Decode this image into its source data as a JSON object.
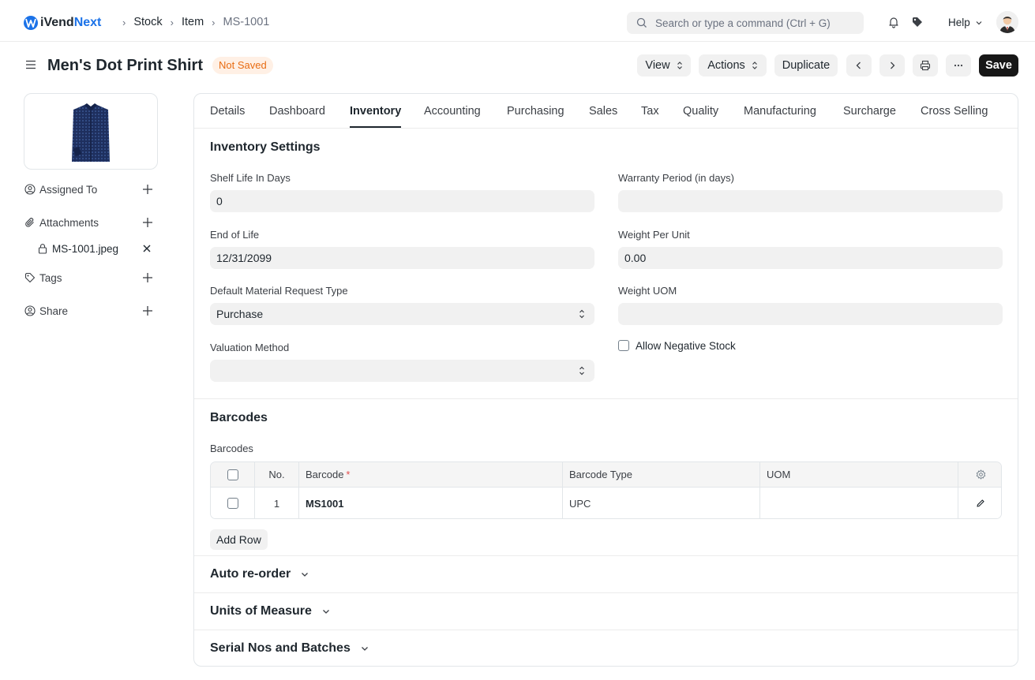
{
  "app": {
    "logo_prefix": "iVend",
    "logo_accent": "Next",
    "brand_color": "#1b72e8"
  },
  "breadcrumb": [
    "Stock",
    "Item",
    "MS-1001"
  ],
  "search": {
    "placeholder": "Search or type a command (Ctrl + G)"
  },
  "navbar": {
    "help_label": "Help"
  },
  "page": {
    "title": "Men's Dot Print Shirt",
    "status": "Not Saved",
    "buttons": {
      "view": "View",
      "actions": "Actions",
      "duplicate": "Duplicate",
      "save": "Save"
    }
  },
  "sidebar": {
    "assigned_to": "Assigned To",
    "attachments": "Attachments",
    "attachment_file": "MS-1001.jpeg",
    "tags": "Tags",
    "share": "Share"
  },
  "tabs": [
    "Details",
    "Dashboard",
    "Inventory",
    "Accounting",
    "Purchasing",
    "Sales",
    "Tax",
    "Quality",
    "Manufacturing",
    "Surcharge",
    "Cross Selling"
  ],
  "active_tab": "Inventory",
  "inventory": {
    "section_title": "Inventory Settings",
    "shelf_life_label": "Shelf Life In Days",
    "shelf_life_value": "0",
    "warranty_label": "Warranty Period (in days)",
    "warranty_value": "",
    "end_of_life_label": "End of Life",
    "end_of_life_value": "12/31/2099",
    "weight_per_unit_label": "Weight Per Unit",
    "weight_per_unit_value": "0.00",
    "material_request_label": "Default Material Request Type",
    "material_request_value": "Purchase",
    "weight_uom_label": "Weight UOM",
    "weight_uom_value": "",
    "valuation_label": "Valuation Method",
    "valuation_value": "",
    "allow_negative_label": "Allow Negative Stock",
    "allow_negative_checked": false
  },
  "barcodes": {
    "section_title": "Barcodes",
    "table_label": "Barcodes",
    "columns": {
      "no": "No.",
      "barcode": "Barcode",
      "barcode_type": "Barcode Type",
      "uom": "UOM"
    },
    "rows": [
      {
        "no": "1",
        "barcode": "MS1001",
        "barcode_type": "UPC",
        "uom": ""
      }
    ],
    "add_row": "Add Row"
  },
  "collapsibles": {
    "auto_reorder": "Auto re-order",
    "units_of_measure": "Units of Measure",
    "serial_batches": "Serial Nos and Batches"
  }
}
